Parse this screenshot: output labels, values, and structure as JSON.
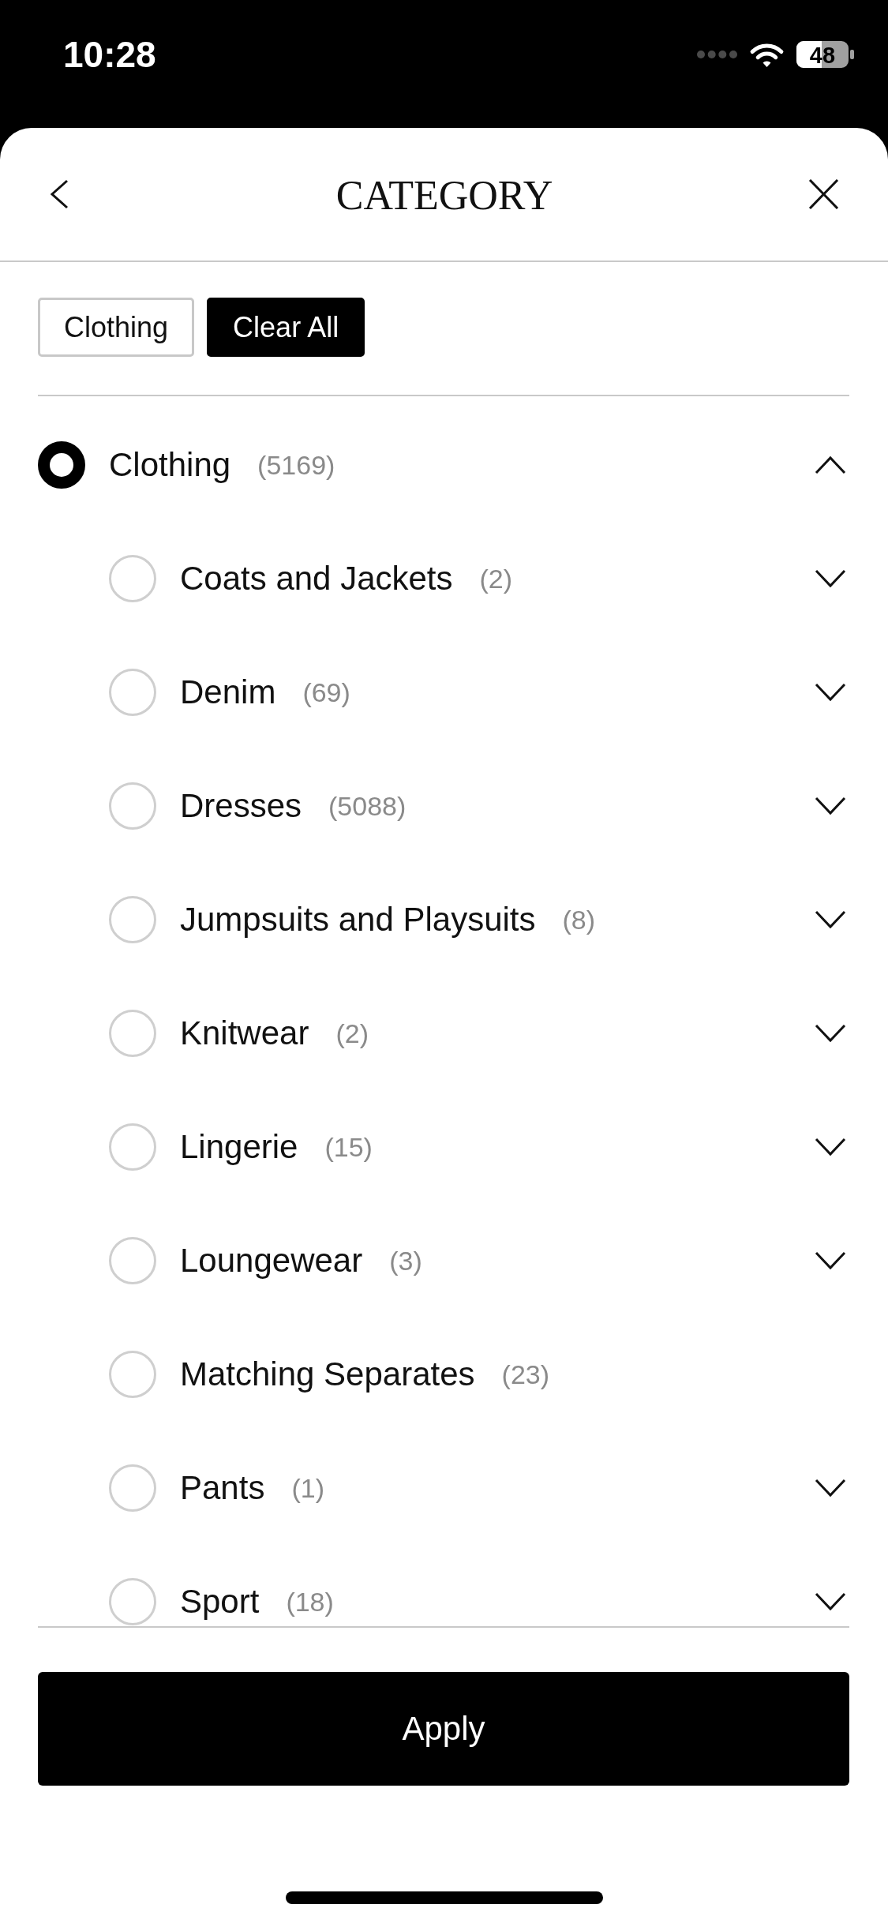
{
  "status_bar": {
    "time": "10:28",
    "battery": "48"
  },
  "header": {
    "title": "CATEGORY"
  },
  "chips": [
    {
      "label": "Clothing",
      "kind": "filter"
    },
    {
      "label": "Clear All",
      "kind": "clear"
    }
  ],
  "categories": [
    {
      "name": "Clothing",
      "count": "(5169)",
      "selected": true,
      "expandable": true,
      "expanded": true,
      "children": [
        {
          "name": "Coats and Jackets",
          "count": "(2)",
          "selected": false,
          "expandable": true,
          "expanded": false
        },
        {
          "name": "Denim",
          "count": "(69)",
          "selected": false,
          "expandable": true,
          "expanded": false
        },
        {
          "name": "Dresses",
          "count": "(5088)",
          "selected": false,
          "expandable": true,
          "expanded": false
        },
        {
          "name": "Jumpsuits and Playsuits",
          "count": "(8)",
          "selected": false,
          "expandable": true,
          "expanded": false
        },
        {
          "name": "Knitwear",
          "count": "(2)",
          "selected": false,
          "expandable": true,
          "expanded": false
        },
        {
          "name": "Lingerie",
          "count": "(15)",
          "selected": false,
          "expandable": true,
          "expanded": false
        },
        {
          "name": "Loungewear",
          "count": "(3)",
          "selected": false,
          "expandable": true,
          "expanded": false
        },
        {
          "name": "Matching Separates",
          "count": "(23)",
          "selected": false,
          "expandable": false
        },
        {
          "name": "Pants",
          "count": "(1)",
          "selected": false,
          "expandable": true,
          "expanded": false
        },
        {
          "name": "Sport",
          "count": "(18)",
          "selected": false,
          "expandable": true,
          "expanded": false
        }
      ]
    }
  ],
  "apply_button": {
    "label": "Apply"
  }
}
